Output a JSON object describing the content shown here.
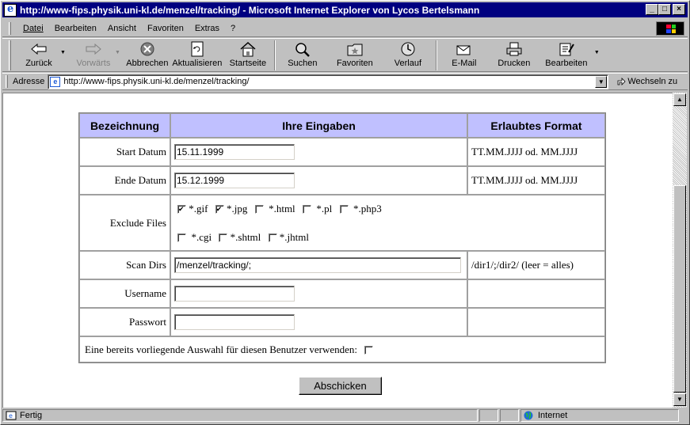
{
  "window": {
    "title": "http://www-fips.physik.uni-kl.de/menzel/tracking/ - Microsoft Internet Explorer von Lycos Bertelsmann",
    "min_label": "_",
    "max_label": "□",
    "close_label": "×"
  },
  "menu": {
    "items": [
      "Datei",
      "Bearbeiten",
      "Ansicht",
      "Favoriten",
      "Extras",
      "?"
    ]
  },
  "toolbar": {
    "back": "Zurück",
    "forward": "Vorwärts",
    "stop": "Abbrechen",
    "refresh": "Aktualisieren",
    "home": "Startseite",
    "search": "Suchen",
    "favorites": "Favoriten",
    "history": "Verlauf",
    "mail": "E-Mail",
    "print": "Drucken",
    "edit": "Bearbeiten"
  },
  "address": {
    "label": "Adresse",
    "url": "http://www-fips.physik.uni-kl.de/menzel/tracking/",
    "go": "Wechseln zu"
  },
  "form": {
    "headers": [
      "Bezeichnung",
      "Ihre Eingaben",
      "Erlaubtes Format"
    ],
    "start_label": "Start Datum",
    "start_value": "15.11.1999",
    "start_format": "TT.MM.JJJJ od. MM.JJJJ",
    "end_label": "Ende Datum",
    "end_value": "15.12.1999",
    "end_format": "TT.MM.JJJJ od. MM.JJJJ",
    "exclude_label": "Exclude Files",
    "exclude_row1": [
      {
        "label": "*.gif",
        "checked": true
      },
      {
        "label": "*.jpg",
        "checked": true
      },
      {
        "label": "*.html",
        "checked": false
      },
      {
        "label": "*.pl",
        "checked": false
      },
      {
        "label": "*.php3",
        "checked": false
      }
    ],
    "exclude_row2": [
      {
        "label": "*.cgi",
        "checked": false
      },
      {
        "label": "*.shtml",
        "checked": false
      },
      {
        "label": "*.jhtml",
        "checked": false
      }
    ],
    "scan_label": "Scan Dirs",
    "scan_value": "/menzel/tracking/;",
    "scan_format": "/dir1/;/dir2/ (leer = alles)",
    "user_label": "Username",
    "user_value": "",
    "pass_label": "Passwort",
    "pass_value": "",
    "reuse_label": "Eine bereits vorliegende Auswahl für diesen Benutzer verwenden:",
    "reuse_checked": false,
    "submit": "Abschicken"
  },
  "status": {
    "text": "Fertig",
    "zone": "Internet"
  }
}
